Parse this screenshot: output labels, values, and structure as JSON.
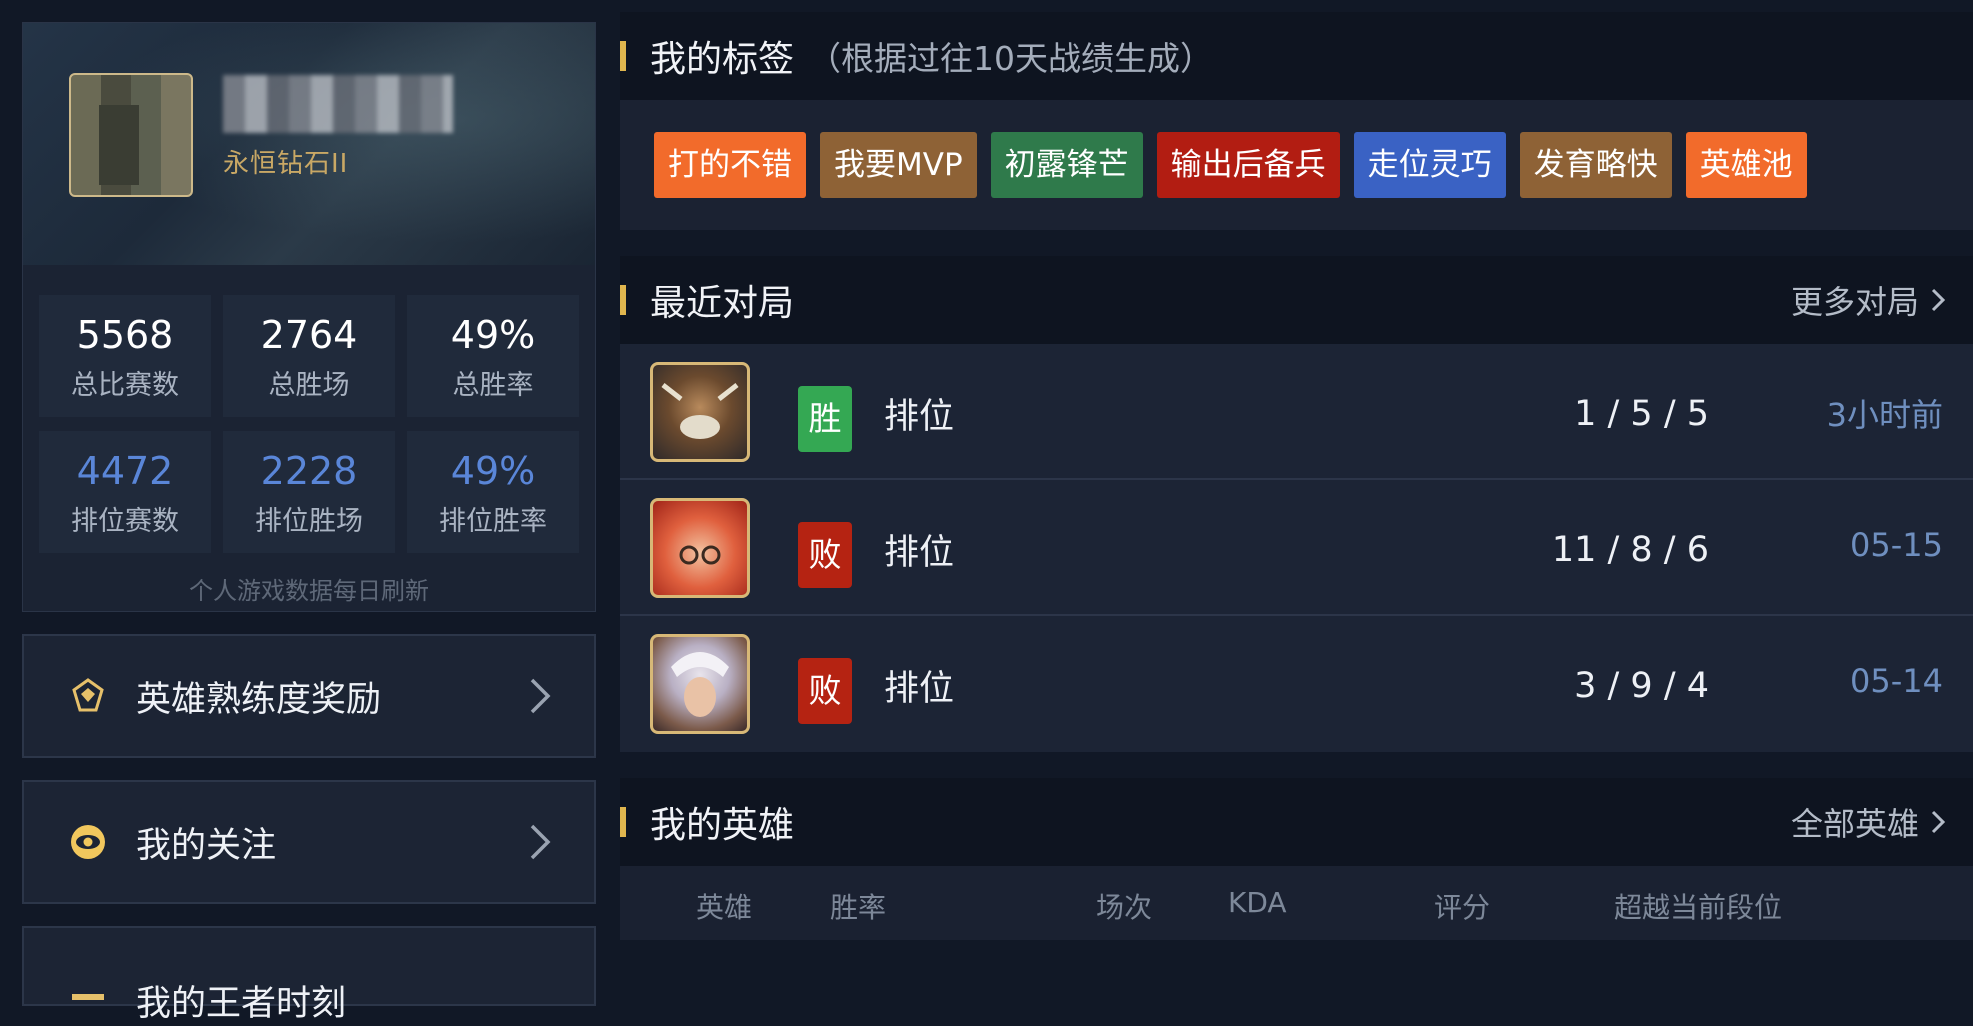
{
  "profile": {
    "rank": "永恒钻石II",
    "stats": [
      {
        "value": "5568",
        "label": "总比赛数"
      },
      {
        "value": "2764",
        "label": "总胜场"
      },
      {
        "value": "49%",
        "label": "总胜率"
      },
      {
        "value": "4472",
        "label": "排位赛数"
      },
      {
        "value": "2228",
        "label": "排位胜场"
      },
      {
        "value": "49%",
        "label": "排位胜率"
      }
    ],
    "refresh_note": "个人游戏数据每日刷新"
  },
  "menu": [
    {
      "label": "英雄熟练度奖励",
      "icon": "badge-icon"
    },
    {
      "label": "我的关注",
      "icon": "eye-icon"
    },
    {
      "label": "我的王者时刻",
      "icon": "moment-icon"
    }
  ],
  "tags_section": {
    "title": "我的标签",
    "subtitle": "（根据过往10天战绩生成）",
    "tags": [
      {
        "label": "打的不错",
        "color": "#f26b2b"
      },
      {
        "label": "我要MVP",
        "color": "#8e6236"
      },
      {
        "label": "初露锋芒",
        "color": "#2f7a4b"
      },
      {
        "label": "输出后备兵",
        "color": "#b21d12"
      },
      {
        "label": "走位灵巧",
        "color": "#3a62c4"
      },
      {
        "label": "发育略快",
        "color": "#8e6236"
      },
      {
        "label": "英雄池",
        "color": "#f26b2b"
      }
    ]
  },
  "recent_section": {
    "title": "最近对局",
    "more_label": "更多对局",
    "matches": [
      {
        "result": "胜",
        "result_color": "#34a853",
        "mode": "排位",
        "kda": "1 / 5 / 5",
        "time": "3小时前"
      },
      {
        "result": "败",
        "result_color": "#b52312",
        "mode": "排位",
        "kda": "11 / 8 / 6",
        "time": "05-15"
      },
      {
        "result": "败",
        "result_color": "#b52312",
        "mode": "排位",
        "kda": "3 / 9 / 4",
        "time": "05-14"
      }
    ]
  },
  "heroes_section": {
    "title": "我的英雄",
    "more_label": "全部英雄",
    "columns": [
      "英雄",
      "胜率",
      "场次",
      "KDA",
      "评分",
      "超越当前段位"
    ]
  },
  "colors": {
    "accent_gold": "#e0b64e",
    "rank_text": "#c9a865",
    "ranked_stat_blue": "#5a86d8",
    "time_blue": "#6f8fbf"
  }
}
